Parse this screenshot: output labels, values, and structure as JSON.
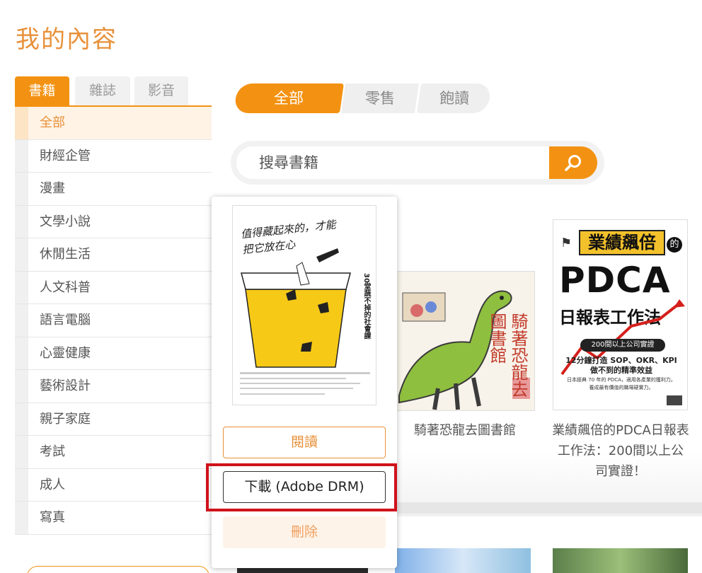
{
  "page": {
    "title": "我的內容"
  },
  "type_tabs": [
    "書籍",
    "雜誌",
    "影音"
  ],
  "categories": [
    "全部",
    "財經企管",
    "漫畫",
    "文學小說",
    "休閒生活",
    "人文科普",
    "語言電腦",
    "心靈健康",
    "藝術設計",
    "親子家庭",
    "考試",
    "成人",
    "寫真"
  ],
  "purchase_tabs": [
    "全部",
    "零售",
    "飽讀"
  ],
  "search": {
    "placeholder": "搜尋書籍"
  },
  "books": [
    {
      "title": "騎著恐龍去圖書館",
      "cover_text": "騎著恐龍去圖書館"
    },
    {
      "title": "業績飆倍的PDCA日報表工作法：200間以上公司實證！",
      "cover_headline": "業績飆倍",
      "cover_of": "的",
      "cover_big": "PDCA",
      "cover_sub": "日報表工作法",
      "cover_badge": "200間以上公司實證",
      "cover_line1": "12分鐘打造 SOP、OKR、KPI",
      "cover_line2": "做不到的精準效益",
      "cover_line3": "日本經典 70 年的 PDCA，適用各產業的獲利力。",
      "cover_line4": "養成最有價值的職場硬實力。"
    }
  ],
  "popup": {
    "cover_handwriting": "值得藏起來的，才能把它放在心",
    "cover_side_title": "30堂蔬不掉的社會課",
    "read_label": "閱讀",
    "download_label": "下載 (Adobe DRM)",
    "delete_label": "刪除"
  },
  "colors": {
    "accent": "#f39212",
    "highlight": "#d0121b"
  },
  "icons": {
    "search": "magnifier-icon"
  }
}
